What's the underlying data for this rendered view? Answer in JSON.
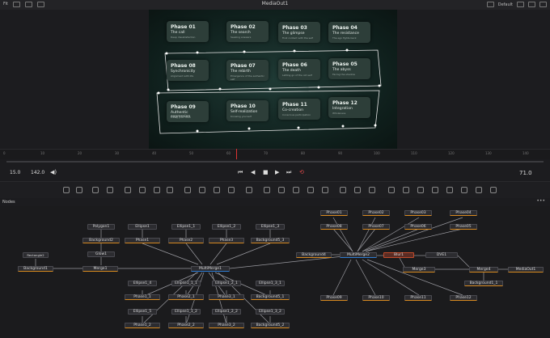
{
  "window": {
    "title": "MediaOut1",
    "left_label": "Fit",
    "right_label": "Default"
  },
  "cards": [
    {
      "title": "Phase 01",
      "subtitle": "The call",
      "small": "Deep dissatisfaction"
    },
    {
      "title": "Phase 02",
      "subtitle": "The search",
      "small": "Seeking answers"
    },
    {
      "title": "Phase 03",
      "subtitle": "The glimpse",
      "small": "First contact with the self"
    },
    {
      "title": "Phase 04",
      "subtitle": "The resistance",
      "small": "The ego fights back"
    },
    {
      "title": "Phase 08",
      "subtitle": "Synchronicity",
      "small": "Alignment with life"
    },
    {
      "title": "Phase 07",
      "subtitle": "The rebirth",
      "small": "Emergence of the authentic self"
    },
    {
      "title": "Phase 06",
      "subtitle": "The death",
      "small": "Letting go of the old self"
    },
    {
      "title": "Phase 05",
      "subtitle": "The abyss",
      "small": "Facing the shadow"
    },
    {
      "title": "Phase 09",
      "subtitle": "Authentic expression",
      "small": "Living your truth"
    },
    {
      "title": "Phase 10",
      "subtitle": "Self-realization",
      "small": "Knowing yourself"
    },
    {
      "title": "Phase 11",
      "subtitle": "Co-creation",
      "small": "Conscious participation"
    },
    {
      "title": "Phase 12",
      "subtitle": "Integration",
      "small": "Wholeness"
    }
  ],
  "ruler": [
    "0",
    "10",
    "20",
    "30",
    "40",
    "50",
    "60",
    "70",
    "80",
    "90",
    "100",
    "110",
    "120",
    "130",
    "140"
  ],
  "transport": {
    "start": "15.0",
    "end": "142.0",
    "current": "71.0"
  },
  "panel": {
    "title": "Nodes",
    "menu": "•••"
  },
  "nodes": {
    "Rectangle2": "Rectangle2",
    "Background1": "Background1",
    "Polygon1": "Polygon1",
    "Background2": "Background2",
    "Glow1": "Glow1",
    "Merge1": "Merge1",
    "Ellipse1": "Ellipse1",
    "Phase1": "Phase1",
    "Ellipse1_1": "Ellipse1_1",
    "Phase2": "Phase2",
    "Ellipse1_2": "Ellipse1_2",
    "Phase3": "Phase3",
    "Ellipse1_3": "Ellipse1_3",
    "Background5_3": "Background5_3",
    "MultiMerge1": "MultiMerge1",
    "Ellipse1_4": "Ellipse1_4",
    "Phase1_1": "Phase1_1",
    "Ellipse1_1_1": "Ellipse1_1_1",
    "Phase2_1": "Phase2_1",
    "Ellipse1_2_1": "Ellipse1_2_1",
    "Phase3_1": "Phase3_1",
    "Ellipse1_3_1": "Ellipse1_3_1",
    "Background5_1": "Background5_1",
    "Ellipse1_5": "Ellipse1_5",
    "Phase1_2": "Phase1_2",
    "Ellipse1_1_2": "Ellipse1_1_2",
    "Phase2_2": "Phase2_2",
    "Ellipse1_2_2": "Ellipse1_2_2",
    "Phase3_2": "Phase3_2",
    "Ellipse1_3_2": "Ellipse1_3_2",
    "Background5_2": "Background5_2",
    "Background4": "Background4",
    "MultiMerge2": "MultiMerge2",
    "Phase01": "Phase01",
    "Phase02": "Phase02",
    "Phase03": "Phase03",
    "Phase04": "Phase04",
    "Phase08": "Phase08",
    "Phase07": "Phase07",
    "Phase06": "Phase06",
    "Phase05": "Phase05",
    "Blur1": "Blur1",
    "DVE1": "DVE1",
    "Merge3": "Merge3",
    "Merge4": "Merge4",
    "MediaOut1": "MediaOut1",
    "Background1_1": "Background1_1",
    "Phase09": "Phase09",
    "Phase10": "Phase10",
    "Phase11": "Phase11",
    "Phase12": "Phase12"
  }
}
